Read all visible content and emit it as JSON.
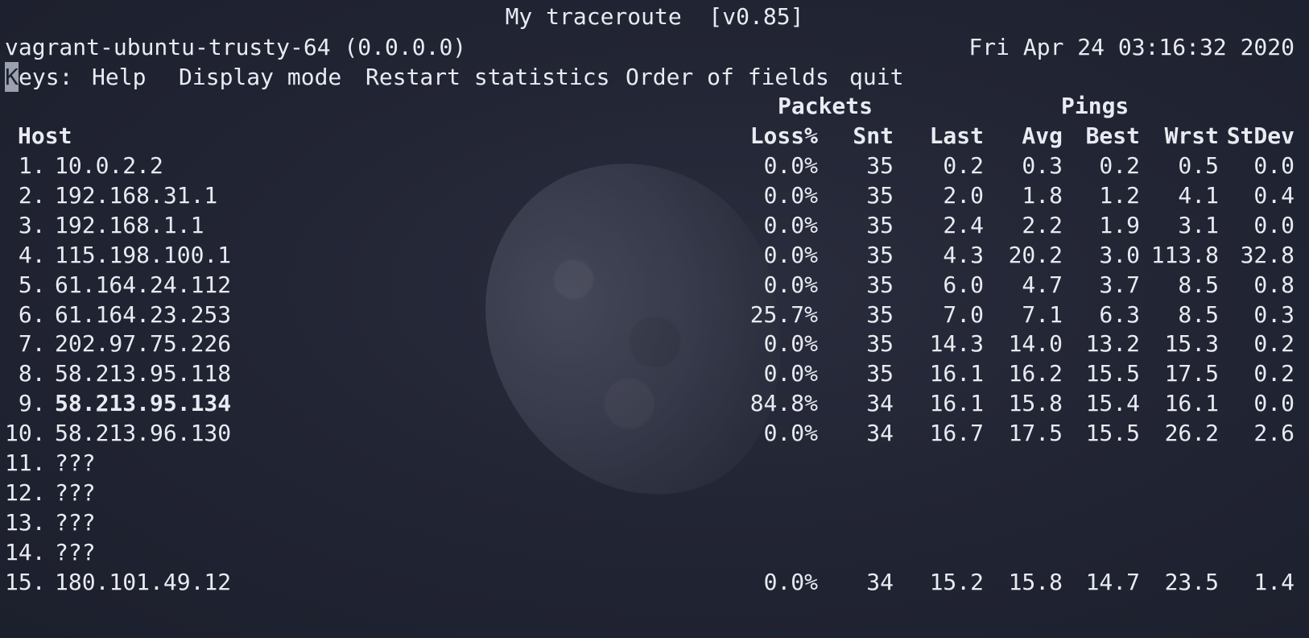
{
  "title": "My traceroute  [v0.85]",
  "host_info": "vagrant-ubuntu-trusty-64 (0.0.0.0)",
  "datetime": "Fri Apr 24 03:16:32 2020",
  "keys": {
    "label_first": "K",
    "label_rest": "eys:",
    "help": "Help",
    "display_mode": "Display mode",
    "restart": "Restart statistics",
    "order": "Order of fields",
    "quit": "quit"
  },
  "groups": {
    "packets": "Packets",
    "pings": "Pings"
  },
  "columns": {
    "host": "Host",
    "loss": "Loss%",
    "snt": "Snt",
    "last": "Last",
    "avg": "Avg",
    "best": "Best",
    "wrst": "Wrst",
    "stdev": "StDev"
  },
  "rows": [
    {
      "num": " 1.",
      "host": "10.0.2.2",
      "loss": "0.0%",
      "snt": "35",
      "last": "0.2",
      "avg": "0.3",
      "best": "0.2",
      "wrst": "0.5",
      "stdev": "0.0"
    },
    {
      "num": " 2.",
      "host": "192.168.31.1",
      "loss": "0.0%",
      "snt": "35",
      "last": "2.0",
      "avg": "1.8",
      "best": "1.2",
      "wrst": "4.1",
      "stdev": "0.4"
    },
    {
      "num": " 3.",
      "host": "192.168.1.1",
      "loss": "0.0%",
      "snt": "35",
      "last": "2.4",
      "avg": "2.2",
      "best": "1.9",
      "wrst": "3.1",
      "stdev": "0.0"
    },
    {
      "num": " 4.",
      "host": "115.198.100.1",
      "loss": "0.0%",
      "snt": "35",
      "last": "4.3",
      "avg": "20.2",
      "best": "3.0",
      "wrst": "113.8",
      "stdev": "32.8"
    },
    {
      "num": " 5.",
      "host": "61.164.24.112",
      "loss": "0.0%",
      "snt": "35",
      "last": "6.0",
      "avg": "4.7",
      "best": "3.7",
      "wrst": "8.5",
      "stdev": "0.8"
    },
    {
      "num": " 6.",
      "host": "61.164.23.253",
      "loss": "25.7%",
      "snt": "35",
      "last": "7.0",
      "avg": "7.1",
      "best": "6.3",
      "wrst": "8.5",
      "stdev": "0.3"
    },
    {
      "num": " 7.",
      "host": "202.97.75.226",
      "loss": "0.0%",
      "snt": "35",
      "last": "14.3",
      "avg": "14.0",
      "best": "13.2",
      "wrst": "15.3",
      "stdev": "0.2"
    },
    {
      "num": " 8.",
      "host": "58.213.95.118",
      "loss": "0.0%",
      "snt": "35",
      "last": "16.1",
      "avg": "16.2",
      "best": "15.5",
      "wrst": "17.5",
      "stdev": "0.2"
    },
    {
      "num": " 9.",
      "host": "58.213.95.134",
      "loss": "84.8%",
      "snt": "34",
      "last": "16.1",
      "avg": "15.8",
      "best": "15.4",
      "wrst": "16.1",
      "stdev": "0.0",
      "bold": true
    },
    {
      "num": "10.",
      "host": "58.213.96.130",
      "loss": "0.0%",
      "snt": "34",
      "last": "16.7",
      "avg": "17.5",
      "best": "15.5",
      "wrst": "26.2",
      "stdev": "2.6"
    },
    {
      "num": "11.",
      "host": "???",
      "loss": "",
      "snt": "",
      "last": "",
      "avg": "",
      "best": "",
      "wrst": "",
      "stdev": ""
    },
    {
      "num": "12.",
      "host": "???",
      "loss": "",
      "snt": "",
      "last": "",
      "avg": "",
      "best": "",
      "wrst": "",
      "stdev": ""
    },
    {
      "num": "13.",
      "host": "???",
      "loss": "",
      "snt": "",
      "last": "",
      "avg": "",
      "best": "",
      "wrst": "",
      "stdev": ""
    },
    {
      "num": "14.",
      "host": "???",
      "loss": "",
      "snt": "",
      "last": "",
      "avg": "",
      "best": "",
      "wrst": "",
      "stdev": ""
    },
    {
      "num": "15.",
      "host": "180.101.49.12",
      "loss": "0.0%",
      "snt": "34",
      "last": "15.2",
      "avg": "15.8",
      "best": "14.7",
      "wrst": "23.5",
      "stdev": "1.4"
    }
  ]
}
